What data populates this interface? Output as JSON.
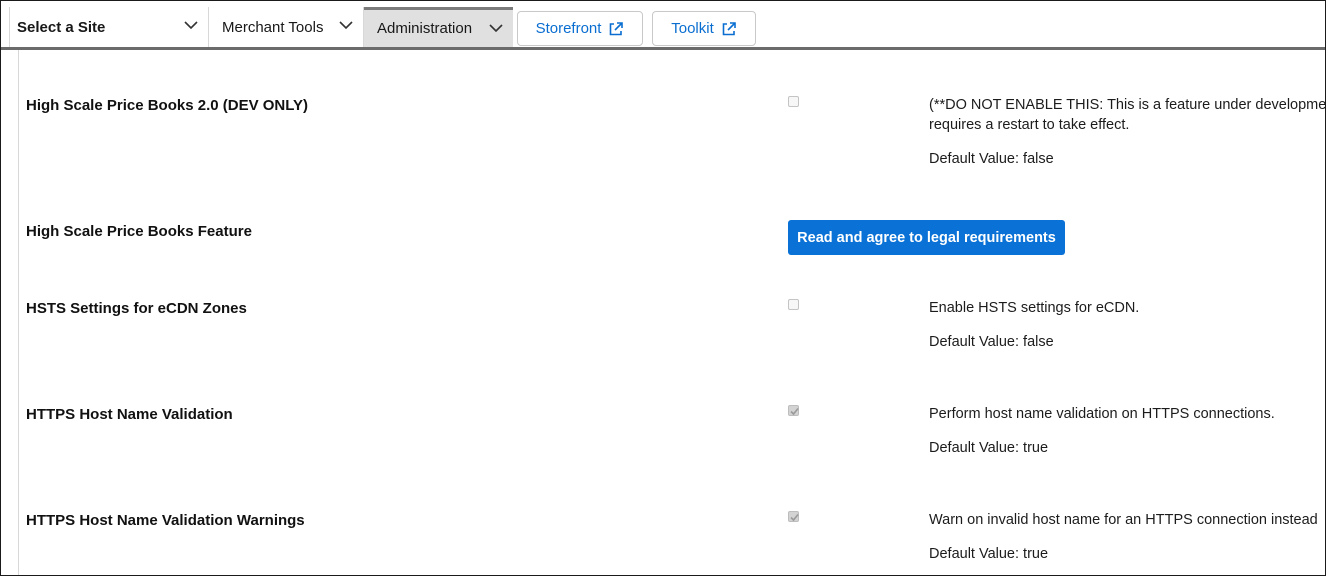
{
  "nav": {
    "site_selector": "Select a Site",
    "merchant_tools": "Merchant Tools",
    "administration": "Administration",
    "storefront": "Storefront",
    "toolkit": "Toolkit"
  },
  "preferences": [
    {
      "name": "High Scale Price Books 2.0 (DEV ONLY)",
      "checked": false,
      "description_line1": "(**DO NOT ENABLE THIS: This is a feature under development",
      "description_line2": "requires a restart to take effect.",
      "default": "Default Value: false"
    },
    {
      "name": "High Scale Price Books Feature",
      "button": "Read and agree to legal requirements"
    },
    {
      "name": "HSTS Settings for eCDN Zones",
      "checked": false,
      "description_line1": "Enable HSTS settings for eCDN.",
      "default": "Default Value: false"
    },
    {
      "name": "HTTPS Host Name Validation",
      "checked": true,
      "description_line1": "Perform host name validation on HTTPS connections.",
      "default": "Default Value: true"
    },
    {
      "name": "HTTPS Host Name Validation Warnings",
      "checked": true,
      "description_line1": "Warn on invalid host name for an HTTPS connection instead",
      "default": "Default Value: true"
    }
  ],
  "colors": {
    "accent": "#0a72d6",
    "link": "#0a6ed1",
    "active_tab": "#e0e0e0"
  },
  "icons": [
    "chevron-down-icon",
    "external-link-icon",
    "checkbox"
  ]
}
